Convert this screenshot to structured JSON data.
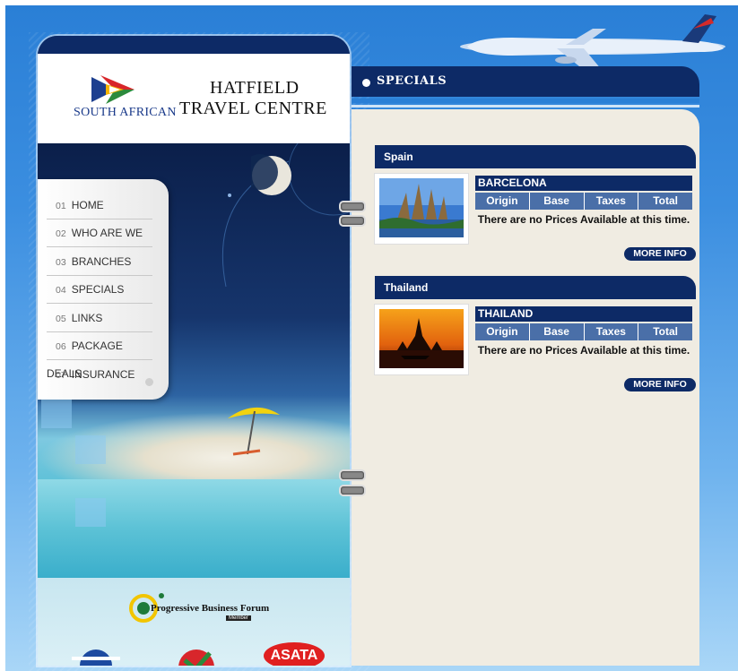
{
  "brand": {
    "airline": "SOUTH AFRICAN",
    "agency_line1": "HATFIELD",
    "agency_line2": "TRAVEL CENTRE"
  },
  "nav": [
    {
      "num": "01",
      "label": "HOME"
    },
    {
      "num": "02",
      "label": "WHO ARE WE"
    },
    {
      "num": "03",
      "label": "BRANCHES"
    },
    {
      "num": "04",
      "label": "SPECIALS"
    },
    {
      "num": "05",
      "label": "LINKS"
    },
    {
      "num": "06",
      "label": "PACKAGE DEALS"
    },
    {
      "num": "07",
      "label": "INSURANCE"
    }
  ],
  "partners": {
    "pbf": "Progressive Business Forum",
    "pbf_member": "Member",
    "asata": "ASATA"
  },
  "section_title": "SPECIALS",
  "specials": [
    {
      "country": "Spain",
      "city": "BARCELONA",
      "columns": [
        "Origin",
        "Base",
        "Taxes",
        "Total"
      ],
      "message": "There are no Prices Available at this time.",
      "button": "MORE INFO"
    },
    {
      "country": "Thailand",
      "city": "THAILAND",
      "columns": [
        "Origin",
        "Base",
        "Taxes",
        "Total"
      ],
      "message": "There are no Prices Available at this time.",
      "button": "MORE INFO"
    }
  ],
  "colors": {
    "navy": "#0d2a66",
    "header_blue": "#4a6fa8",
    "panel_bg": "#f0ece2",
    "sky": "#2a7fd6"
  }
}
